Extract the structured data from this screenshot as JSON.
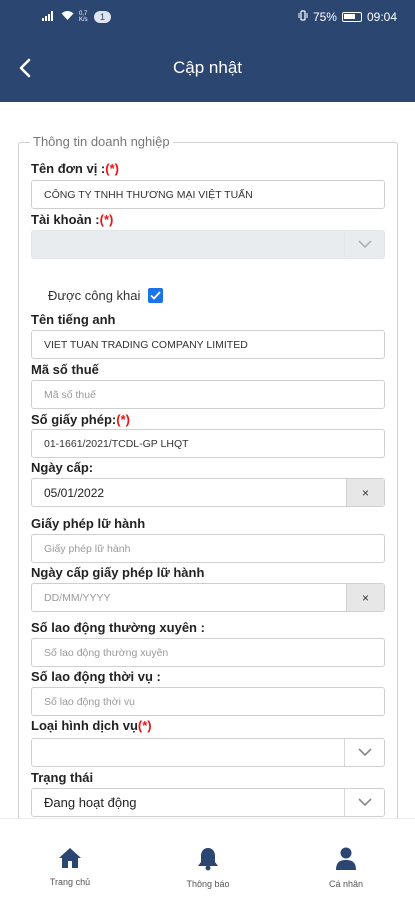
{
  "status_bar": {
    "time": "09:04",
    "battery": "75%",
    "net_small_top": "0,7",
    "net_small_bottom": "K/s",
    "badge": "1"
  },
  "header": {
    "title": "Cập nhật"
  },
  "form": {
    "legend": "Thông tin doanh nghiệp",
    "ten_don_vi": {
      "label": "Tên đơn vị :",
      "req": "(*)",
      "value": "CÔNG TY TNHH THƯƠNG MẠI VIỆT TUẤN"
    },
    "tai_khoan": {
      "label": "Tài khoản :",
      "req": "(*)",
      "value": ""
    },
    "cong_khai": {
      "label": "Được công khai",
      "checked": true
    },
    "ten_tieng_anh": {
      "label": "Tên tiếng anh",
      "value": "VIET TUAN TRADING COMPANY LIMITED"
    },
    "ma_so_thue": {
      "label": "Mã số thuế",
      "placeholder": "Mã số thuế"
    },
    "so_giay_phep": {
      "label": "Số giấy phép:",
      "req": "(*)",
      "value": "01-1661/2021/TCDL-GP LHQT"
    },
    "ngay_cap": {
      "label": "Ngày cấp:",
      "value": "05/01/2022",
      "clear": "×"
    },
    "giay_phep_lu_hanh": {
      "label": "Giấy phép lữ hành",
      "placeholder": "Giấy phép lữ hành"
    },
    "ngay_cap_gplh": {
      "label": "Ngày cấp giấy phép lữ hành",
      "placeholder": "DD/MM/YYYY",
      "clear": "×"
    },
    "ld_thuong_xuyen": {
      "label": "Số lao động thường xuyên :",
      "placeholder": "Số lao động thường xuyên"
    },
    "ld_thoi_vu": {
      "label": "Số lao động thời vụ :",
      "placeholder": "Số lao động thời vụ"
    },
    "loai_hinh": {
      "label": "Loại hình dịch vụ",
      "req": "(*)",
      "value": ""
    },
    "trang_thai": {
      "label": "Trạng thái",
      "value": "Đang hoạt động"
    }
  },
  "tabs": {
    "home": "Trang chủ",
    "notify": "Thông báo",
    "profile": "Cá nhân"
  },
  "colors": {
    "primary": "#2c4672",
    "required": "#ee1111",
    "checkbox": "#1a73e8"
  }
}
